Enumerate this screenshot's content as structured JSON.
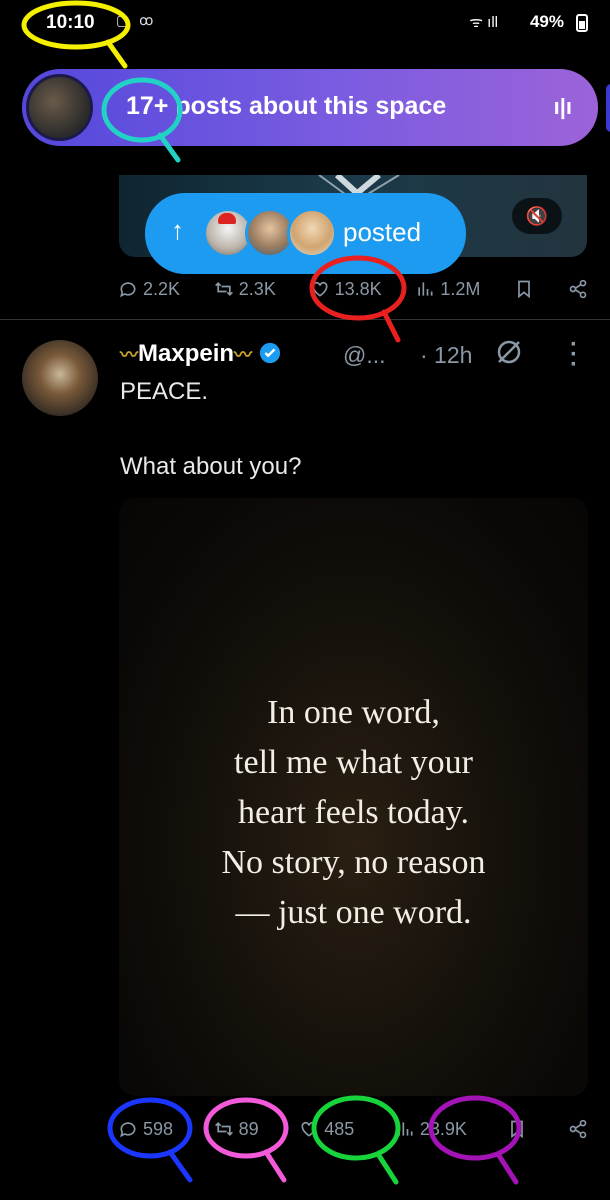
{
  "status_bar": {
    "time": "10:10",
    "left_icons": "▢ ꝏ",
    "right_text": "49%"
  },
  "space_banner": {
    "count": "17+",
    "text": "posts about this space"
  },
  "posted_pill": {
    "label": "posted"
  },
  "prev_post": {
    "metrics": {
      "replies": "2.2K",
      "reposts": "2.3K",
      "likes": "13.8K",
      "views": "1.2M"
    }
  },
  "post": {
    "author_name": "Maxpein",
    "handle": "@...",
    "time_ago": "· 12h",
    "text_line1": "PEACE.",
    "text_line2": "What about you?",
    "image_quote": {
      "line1": "In one word,",
      "line2": "tell me what your",
      "line3": "heart feels today.",
      "line4": "No story, no reason",
      "line5": "— just one word."
    },
    "metrics": {
      "replies": "598",
      "reposts": "89",
      "likes": "485",
      "views": "23.9K"
    }
  },
  "colors": {
    "accent_blue": "#1d9bf0",
    "space_purple": "#7a5ce0",
    "annotation_yellow": "#f5f000",
    "annotation_cyan": "#22d3c5",
    "annotation_red": "#e82020",
    "annotation_blue": "#1a36ff",
    "annotation_pink": "#f25ad9",
    "annotation_green": "#17d43a",
    "annotation_purple": "#a413b5"
  }
}
